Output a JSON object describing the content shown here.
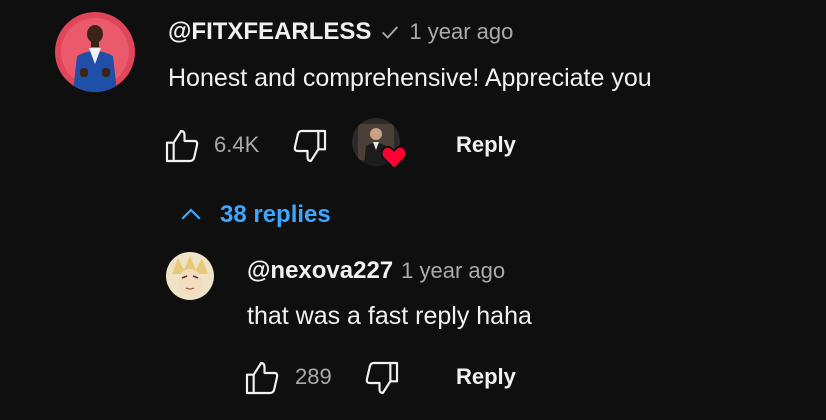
{
  "comment": {
    "author": "@FITXFEARLESS",
    "verified_icon": "check-icon",
    "time": "1 year ago",
    "text": "Honest and comprehensive! Appreciate you",
    "likes": "6.4K",
    "reply_label": "Reply",
    "creator_heart": true
  },
  "replies_toggle": {
    "label": "38 replies",
    "icon": "chevron-up-icon",
    "color": "#3ea6ff"
  },
  "reply": {
    "author": "@nexova227",
    "time": "1 year ago",
    "text": "that was a fast reply haha",
    "likes": "289",
    "reply_label": "Reply"
  },
  "colors": {
    "background": "#0f0f0f",
    "text": "#f1f1f1",
    "meta": "#aaaaaa",
    "heart": "#ff0033"
  }
}
